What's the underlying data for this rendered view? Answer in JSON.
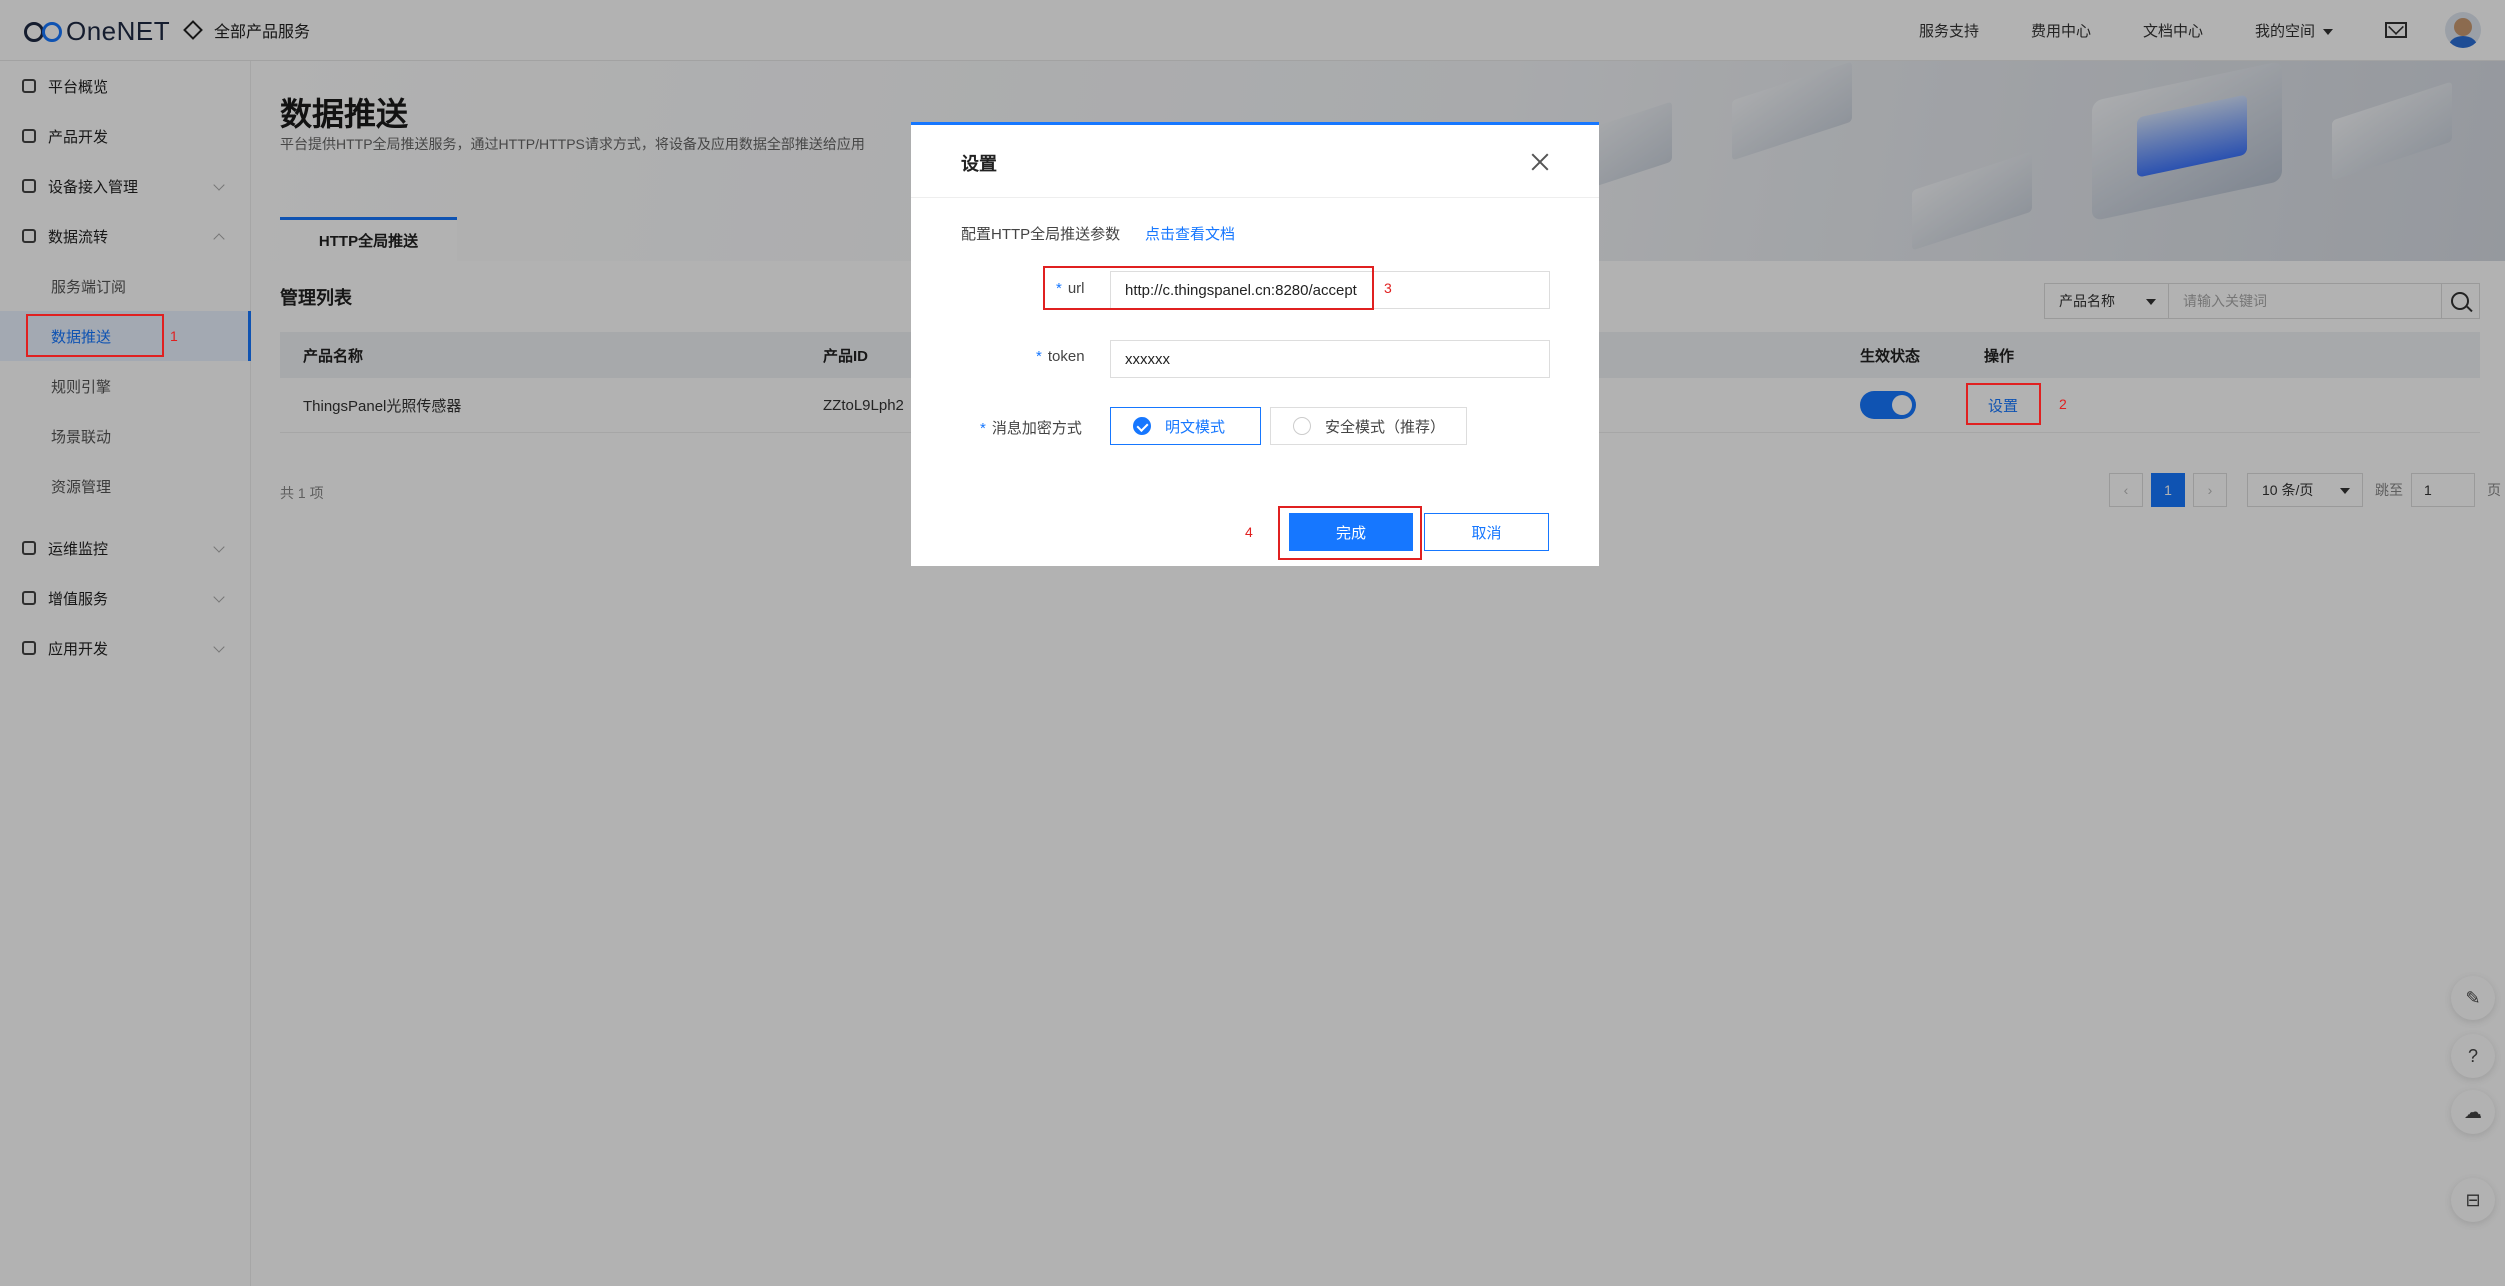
{
  "header": {
    "logo_text": "OneNET",
    "all_products": "全部产品服务",
    "nav": [
      "服务支持",
      "费用中心",
      "文档中心",
      "我的空间"
    ]
  },
  "sidebar": {
    "items": [
      {
        "label": "平台概览",
        "icon": "overview-icon"
      },
      {
        "label": "产品开发",
        "icon": "product-icon"
      },
      {
        "label": "设备接入管理",
        "icon": "device-icon"
      },
      {
        "label": "数据流转",
        "icon": "dataflow-icon"
      },
      {
        "label": "运维监控",
        "icon": "monitor-icon"
      },
      {
        "label": "增值服务",
        "icon": "value-icon"
      },
      {
        "label": "应用开发",
        "icon": "appdev-icon"
      }
    ],
    "sub_items": [
      "服务端订阅",
      "数据推送",
      "规则引擎",
      "场景联动",
      "资源管理"
    ]
  },
  "page": {
    "title": "数据推送",
    "desc": "平台提供HTTP全局推送服务，通过HTTP/HTTPS请求方式，将设备及应用数据全部推送给应用",
    "tab": "HTTP全局推送",
    "list_title": "管理列表",
    "search_field": "产品名称",
    "search_placeholder": "请输入关键词"
  },
  "table": {
    "headers": [
      "产品名称",
      "产品ID",
      "生效状态",
      "操作"
    ],
    "rows": [
      {
        "name": "ThingsPanel光照传感器",
        "id": "ZZtoL9Lph2",
        "enabled": true,
        "action": "设置"
      }
    ],
    "total": "共 1 项"
  },
  "pagination": {
    "current": "1",
    "page_size": "10 条/页",
    "jump_label": "跳至",
    "jump_value": "1",
    "unit": "页"
  },
  "modal": {
    "title": "设置",
    "config_label": "配置HTTP全局推送参数",
    "doc_link": "点击查看文档",
    "url_label": "url",
    "url_value": "http://c.thingspanel.cn:8280/accept",
    "token_label": "token",
    "token_value": "xxxxxx",
    "encrypt_label": "消息加密方式",
    "mode_plain": "明文模式",
    "mode_secure": "安全模式（推荐）",
    "ok": "完成",
    "cancel": "取消"
  },
  "annotations": [
    "1",
    "2",
    "3",
    "4"
  ],
  "colors": {
    "accent": "#1677ff",
    "annotation": "#e02020"
  }
}
